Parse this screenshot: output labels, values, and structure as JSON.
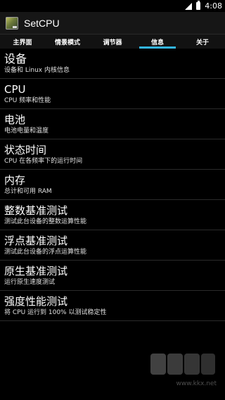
{
  "status": {
    "time": "4:08"
  },
  "titlebar": {
    "title": "SetCPU"
  },
  "tabs": [
    {
      "label": "主界面",
      "active": false
    },
    {
      "label": "情景模式",
      "active": false
    },
    {
      "label": "调节器",
      "active": false
    },
    {
      "label": "信息",
      "active": true
    },
    {
      "label": "关于",
      "active": false
    }
  ],
  "items": [
    {
      "title": "设备",
      "subtitle": "设备和 Linux 内核信息"
    },
    {
      "title": "CPU",
      "subtitle": "CPU 频率和性能"
    },
    {
      "title": "电池",
      "subtitle": "电池电量和温度"
    },
    {
      "title": "状态时间",
      "subtitle": "CPU 在各频率下的运行时间"
    },
    {
      "title": "内存",
      "subtitle": "总计和可用 RAM"
    },
    {
      "title": "整数基准测试",
      "subtitle": "测试此台设备的整数运算性能"
    },
    {
      "title": "浮点基准测试",
      "subtitle": "测试此台设备的浮点运算性能"
    },
    {
      "title": "原生基准测试",
      "subtitle": "运行原生速度测试"
    },
    {
      "title": "强度性能测试",
      "subtitle": "将 CPU 运行到 100% 以测试稳定性"
    }
  ],
  "watermark": {
    "url": "www.kkx.net"
  },
  "colors": {
    "accent": "#33b5e5",
    "background": "#000000",
    "divider": "#2a2a2a"
  }
}
